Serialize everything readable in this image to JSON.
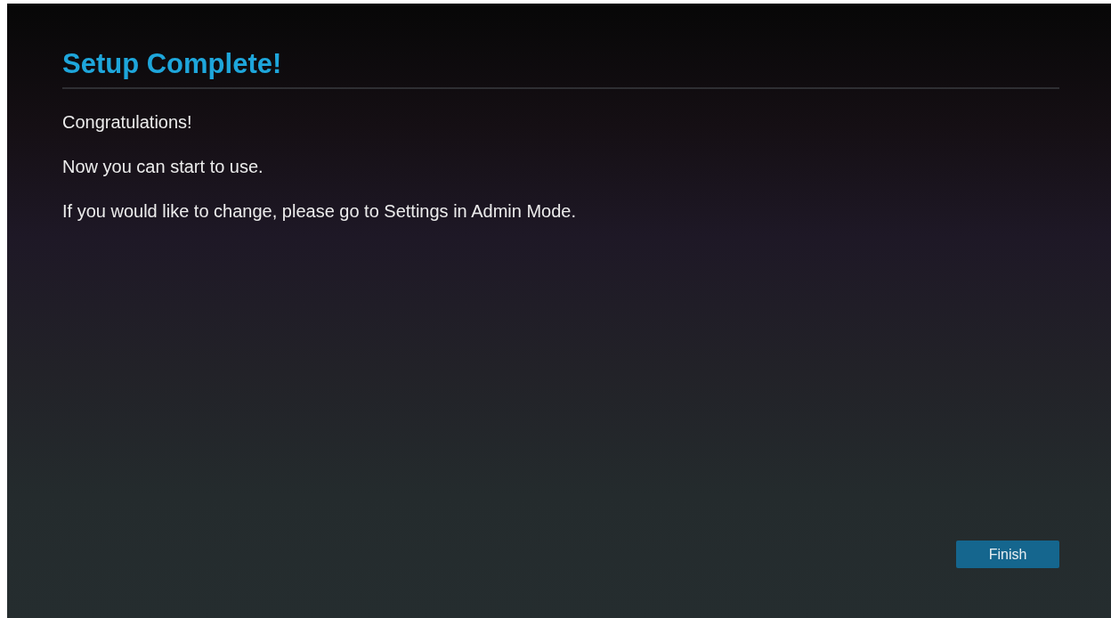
{
  "title": "Setup Complete!",
  "paragraphs": [
    "Congratulations!",
    "Now you can start to use.",
    "If you would like to change, please go to Settings in Admin Mode."
  ],
  "buttons": [
    "Finish"
  ]
}
